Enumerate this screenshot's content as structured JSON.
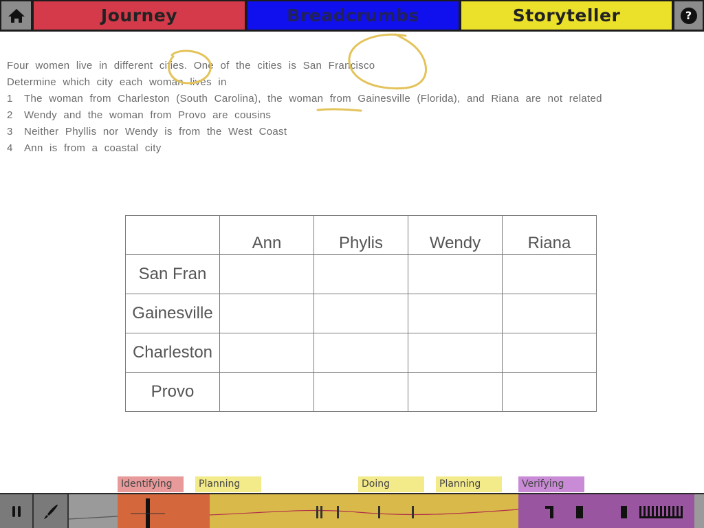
{
  "header": {
    "home_icon": "home-icon",
    "tabs": [
      {
        "label": "Journey",
        "color": "#d43a4a",
        "text_color": "#222222"
      },
      {
        "label": "Breadcrumbs",
        "color": "#1010ee",
        "text_color": "#22225a"
      },
      {
        "label": "Storyteller",
        "color": "#ece12a",
        "text_color": "#222222"
      }
    ],
    "help_label": "?"
  },
  "puzzle": {
    "intro": "Four women live in different cities. One of the cities is San Francisco",
    "question": "Determine which city each woman lives in",
    "clues": [
      {
        "num": "1",
        "text": "The woman from Charleston (South Carolina), the woman from Gainesville (Florida), and Riana are not related"
      },
      {
        "num": "2",
        "text": "Wendy and the woman from Provo are cousins"
      },
      {
        "num": "3",
        "text": "Neither Phyllis nor Wendy is from the West Coast"
      },
      {
        "num": "4",
        "text": "Ann is from a coastal city"
      }
    ]
  },
  "grid": {
    "columns": [
      "Ann",
      "Phylis",
      "Wendy",
      "Riana"
    ],
    "rows": [
      "San Fran",
      "Gainesville",
      "Charleston",
      "Provo"
    ]
  },
  "timeline": {
    "stages": [
      {
        "label": "Identifying",
        "color": "#e89a9a"
      },
      {
        "label": "Planning",
        "color": "#f3ea8a"
      },
      {
        "label": "Doing",
        "color": "#f3ea8a"
      },
      {
        "label": "Planning",
        "color": "#f3ea8a"
      },
      {
        "label": "Verifying",
        "color": "#c98ad6"
      }
    ],
    "segment_colors": {
      "identifying": "#d4673c",
      "planning": "#d9b94a",
      "verifying": "#9a55a0"
    },
    "controls": {
      "pause_icon": "pause-icon",
      "pen_icon": "pen-icon"
    }
  },
  "annotation_color": "#e3c35a"
}
